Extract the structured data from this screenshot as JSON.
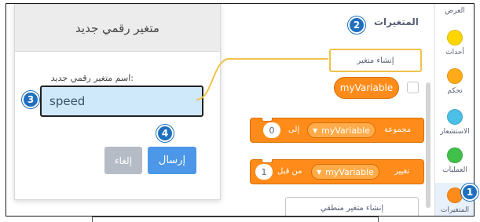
{
  "dialog": {
    "title": "متغير رقمي جديد",
    "field_label": ":اسم متغير رقمي جديد",
    "input_value": "speed",
    "send_label": "إرسال",
    "cancel_label": "إلغاء"
  },
  "palette": {
    "title": "المتغيرات",
    "make_variable_label": "إنشاء متغير",
    "variable_block": "myVariable",
    "set_block": {
      "text": "مجموعة",
      "dropdown": "myVariable",
      "to": "إلى",
      "value": "0"
    },
    "change_block": {
      "text": "تغيير",
      "dropdown": "myVariable",
      "by": "من قبل",
      "value": "1"
    },
    "make_boolean_label": "إنشاء متغير منطقي"
  },
  "categories": [
    {
      "label": "العرض",
      "color": "#9966ff"
    },
    {
      "label": "أحداث",
      "color": "#ffd500"
    },
    {
      "label": "تحكم",
      "color": "#ffab19"
    },
    {
      "label": "الاستشعار",
      "color": "#4cbfe6"
    },
    {
      "label": "العمليات",
      "color": "#40bf4a"
    },
    {
      "label": "المتغيرات",
      "color": "#ff8c1a"
    }
  ],
  "callouts": [
    "1",
    "2",
    "3",
    "4"
  ],
  "colors": {
    "accent": "#4c97e8",
    "variables": "#ff8c1a",
    "highlight": "#f0c24b",
    "callout": "#1f6fbf"
  }
}
